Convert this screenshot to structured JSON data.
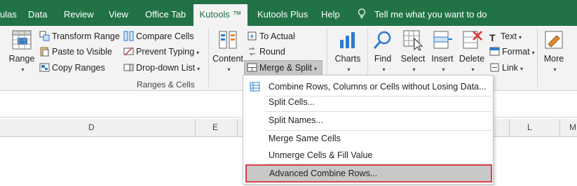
{
  "tabs": [
    {
      "label": "ulas"
    },
    {
      "label": "Data"
    },
    {
      "label": "Review"
    },
    {
      "label": "View"
    },
    {
      "label": "Office Tab"
    },
    {
      "label": "Kutools ™"
    },
    {
      "label": "Kutools Plus"
    },
    {
      "label": "Help"
    }
  ],
  "tell_me": "Tell me what you want to do",
  "ribbon": {
    "range": "Range",
    "transform_range": "Transform Range",
    "paste_to_visible": "Paste to Visible",
    "copy_ranges": "Copy Ranges",
    "compare_cells": "Compare Cells",
    "prevent_typing": "Prevent Typing",
    "dropdown_list": "Drop-down List",
    "group_label": "Ranges & Cells",
    "content": "Content",
    "to_actual": "To Actual",
    "round": "Round",
    "merge_split": "Merge & Split",
    "charts": "Charts",
    "find": "Find",
    "select": "Select",
    "insert": "Insert",
    "delete": "Delete",
    "text": "Text",
    "format": "Format",
    "link": "Link",
    "more": "More"
  },
  "columns": [
    "D",
    "E",
    "L",
    "M"
  ],
  "menu": {
    "items": [
      "Combine Rows, Columns or Cells without Losing Data...",
      "Split Cells...",
      "Split Names...",
      "Merge Same Cells",
      "Unmerge Cells & Fill Value",
      "Advanced Combine Rows..."
    ]
  },
  "colors": {
    "ribbon_green": "#217346",
    "highlight_border": "#d9404a"
  }
}
